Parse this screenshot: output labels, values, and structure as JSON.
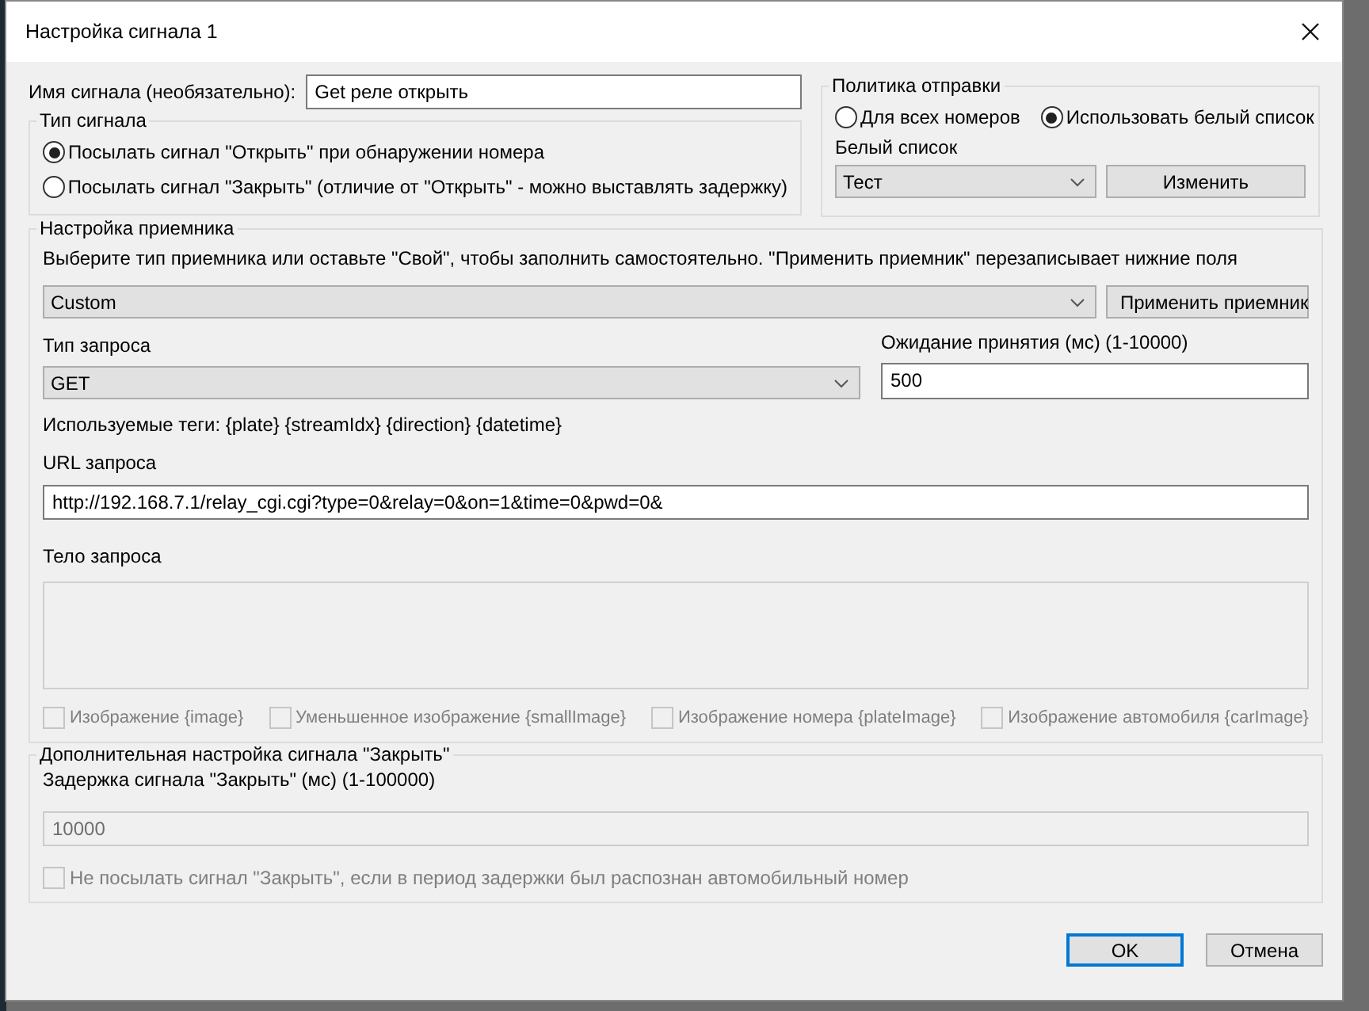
{
  "window": {
    "title": "Настройка сигнала 1"
  },
  "signal_name": {
    "label": "Имя сигнала (необязательно):",
    "value": "Get реле открыть"
  },
  "signal_type": {
    "title": "Тип сигнала",
    "options": [
      {
        "label": "Посылать сигнал \"Открыть\" при обнаружении номера",
        "selected": true
      },
      {
        "label": "Посылать сигнал \"Закрыть\" (отличие от \"Открыть\" - можно выставлять задержку)",
        "selected": false
      }
    ]
  },
  "send_policy": {
    "title": "Политика отправки",
    "options": [
      {
        "label": "Для всех номеров",
        "selected": false
      },
      {
        "label": "Использовать белый список",
        "selected": true
      }
    ],
    "whitelist_label": "Белый список",
    "whitelist_value": "Тест",
    "edit_button": "Изменить"
  },
  "receiver": {
    "title": "Настройка приемника",
    "hint": "Выберите тип приемника или оставьте \"Свой\", чтобы заполнить самостоятельно.  \"Применить приемник\" перезаписывает нижние поля",
    "receiver_type": "Custom",
    "apply_button": "Применить приемник",
    "request_type_label": "Тип запроса",
    "request_type_value": "GET",
    "timeout_label": "Ожидание принятия (мс) (1-10000)",
    "timeout_value": "500",
    "tags_text": "Используемые теги: {plate} {streamIdx} {direction} {datetime}",
    "url_label": "URL запроса",
    "url_value": "http://192.168.7.1/relay_cgi.cgi?type=0&relay=0&on=1&time=0&pwd=0&",
    "body_label": "Тело запроса",
    "body_disabled": true,
    "attachments": [
      {
        "label": "Изображение {image}",
        "checked": false,
        "disabled": true
      },
      {
        "label": "Уменьшенное изображение {smallImage}",
        "checked": false,
        "disabled": true
      },
      {
        "label": "Изображение номера {plateImage}",
        "checked": false,
        "disabled": true
      },
      {
        "label": "Изображение автомобиля {carImage}",
        "checked": false,
        "disabled": true
      }
    ]
  },
  "close_settings": {
    "title": "Дополнительная настройка сигнала \"Закрыть\"",
    "delay_label": "Задержка сигнала \"Закрыть\" (мс) (1-100000)",
    "delay_value": "10000",
    "delay_disabled": true,
    "skip_checkbox": {
      "label": "Не посылать сигнал \"Закрыть\", если в период задержки был распознан автомобильный номер",
      "checked": false,
      "disabled": true
    }
  },
  "buttons": [
    {
      "label": "OK",
      "default": true
    },
    {
      "label": "Отмена",
      "default": false
    }
  ]
}
